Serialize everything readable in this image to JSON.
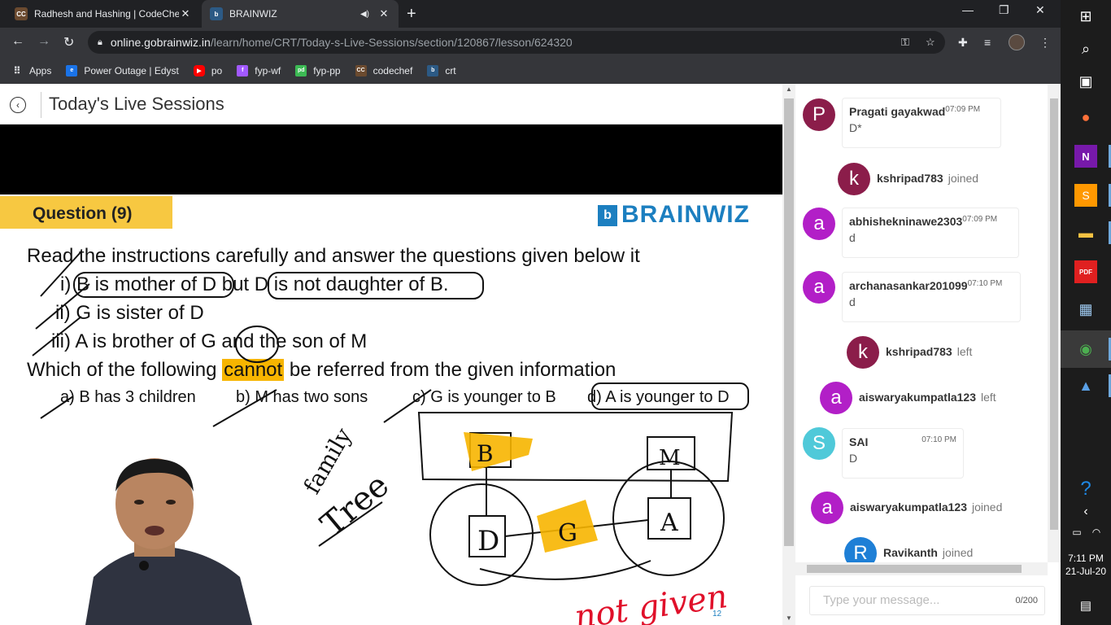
{
  "browser": {
    "tabs": [
      {
        "title": "Radhesh and Hashing | CodeChef",
        "favicon": "CC"
      },
      {
        "title": "BRAINWIZ",
        "favicon": "b"
      }
    ],
    "url_host": "online.gobrainwiz.in",
    "url_path": "/learn/home/CRT/Today-s-Live-Sessions/section/120867/lesson/624320",
    "bookmarks": [
      {
        "label": "Apps",
        "color": "#e8eaed"
      },
      {
        "label": "Power Outage | Edyst",
        "color": "#1a73e8"
      },
      {
        "label": "po",
        "color": "#ff0000"
      },
      {
        "label": "fyp-wf",
        "color": "#a259ff"
      },
      {
        "label": "fyp-pp",
        "color": "#3cba54"
      },
      {
        "label": "codechef",
        "color": "#6b4a2f"
      },
      {
        "label": "crt",
        "color": "#2c5a85"
      }
    ]
  },
  "page": {
    "title": "Today's Live Sessions"
  },
  "slide": {
    "question_label": "Question (9)",
    "logo_mark": "b",
    "logo_text": "BRAINWIZ",
    "intro": "Read the instructions carefully and answer the questions given below it",
    "stmt1": "i) B is mother of D but D is not daughter of B.",
    "stmt2": "ii) G is sister of D",
    "stmt3": "iii) A is brother of G and the son of M",
    "q_part1": "Which of the following ",
    "q_hl": "cannot",
    "q_part2": " be referred from the given information",
    "opt_a": "a)  B has 3 children",
    "opt_b": "b) M has two sons",
    "opt_c": "c) G is younger to B",
    "opt_d": "d) A is younger to D",
    "page_number": "12",
    "handwriting": {
      "family": "family",
      "tree": "Tree",
      "B": "B",
      "M": "M",
      "D": "D",
      "G": "G",
      "A": "A",
      "not_given": "not given"
    }
  },
  "chat": {
    "messages": [
      {
        "type": "msg",
        "initial": "P",
        "name": "Pragati gayakwad",
        "time": "07:09 PM",
        "text": "D*"
      },
      {
        "type": "sys",
        "initial": "k",
        "name": "kshripad783",
        "action": "joined"
      },
      {
        "type": "msg",
        "initial": "a",
        "name": "abhishekninawe2303",
        "time": "07:09 PM",
        "text": "d"
      },
      {
        "type": "msg",
        "initial": "a",
        "name": "archanasankar201099",
        "time": "07:10 PM",
        "text": "d"
      },
      {
        "type": "sys",
        "initial": "k",
        "name": "kshripad783",
        "action": "left"
      },
      {
        "type": "sys",
        "initial": "a",
        "name": "aiswaryakumpatla123",
        "action": "left"
      },
      {
        "type": "msg",
        "initial": "S",
        "name": "SAI",
        "time": "07:10 PM",
        "text": "D"
      },
      {
        "type": "sys",
        "initial": "a",
        "name": "aiswaryakumpatla123",
        "action": "joined"
      },
      {
        "type": "sys",
        "initial": "R",
        "name": "Ravikanth",
        "action": "joined"
      }
    ],
    "input_placeholder": "Type your message...",
    "counter": "0/200"
  },
  "taskbar": {
    "time": "7:11 PM",
    "date": "21-Jul-20"
  }
}
